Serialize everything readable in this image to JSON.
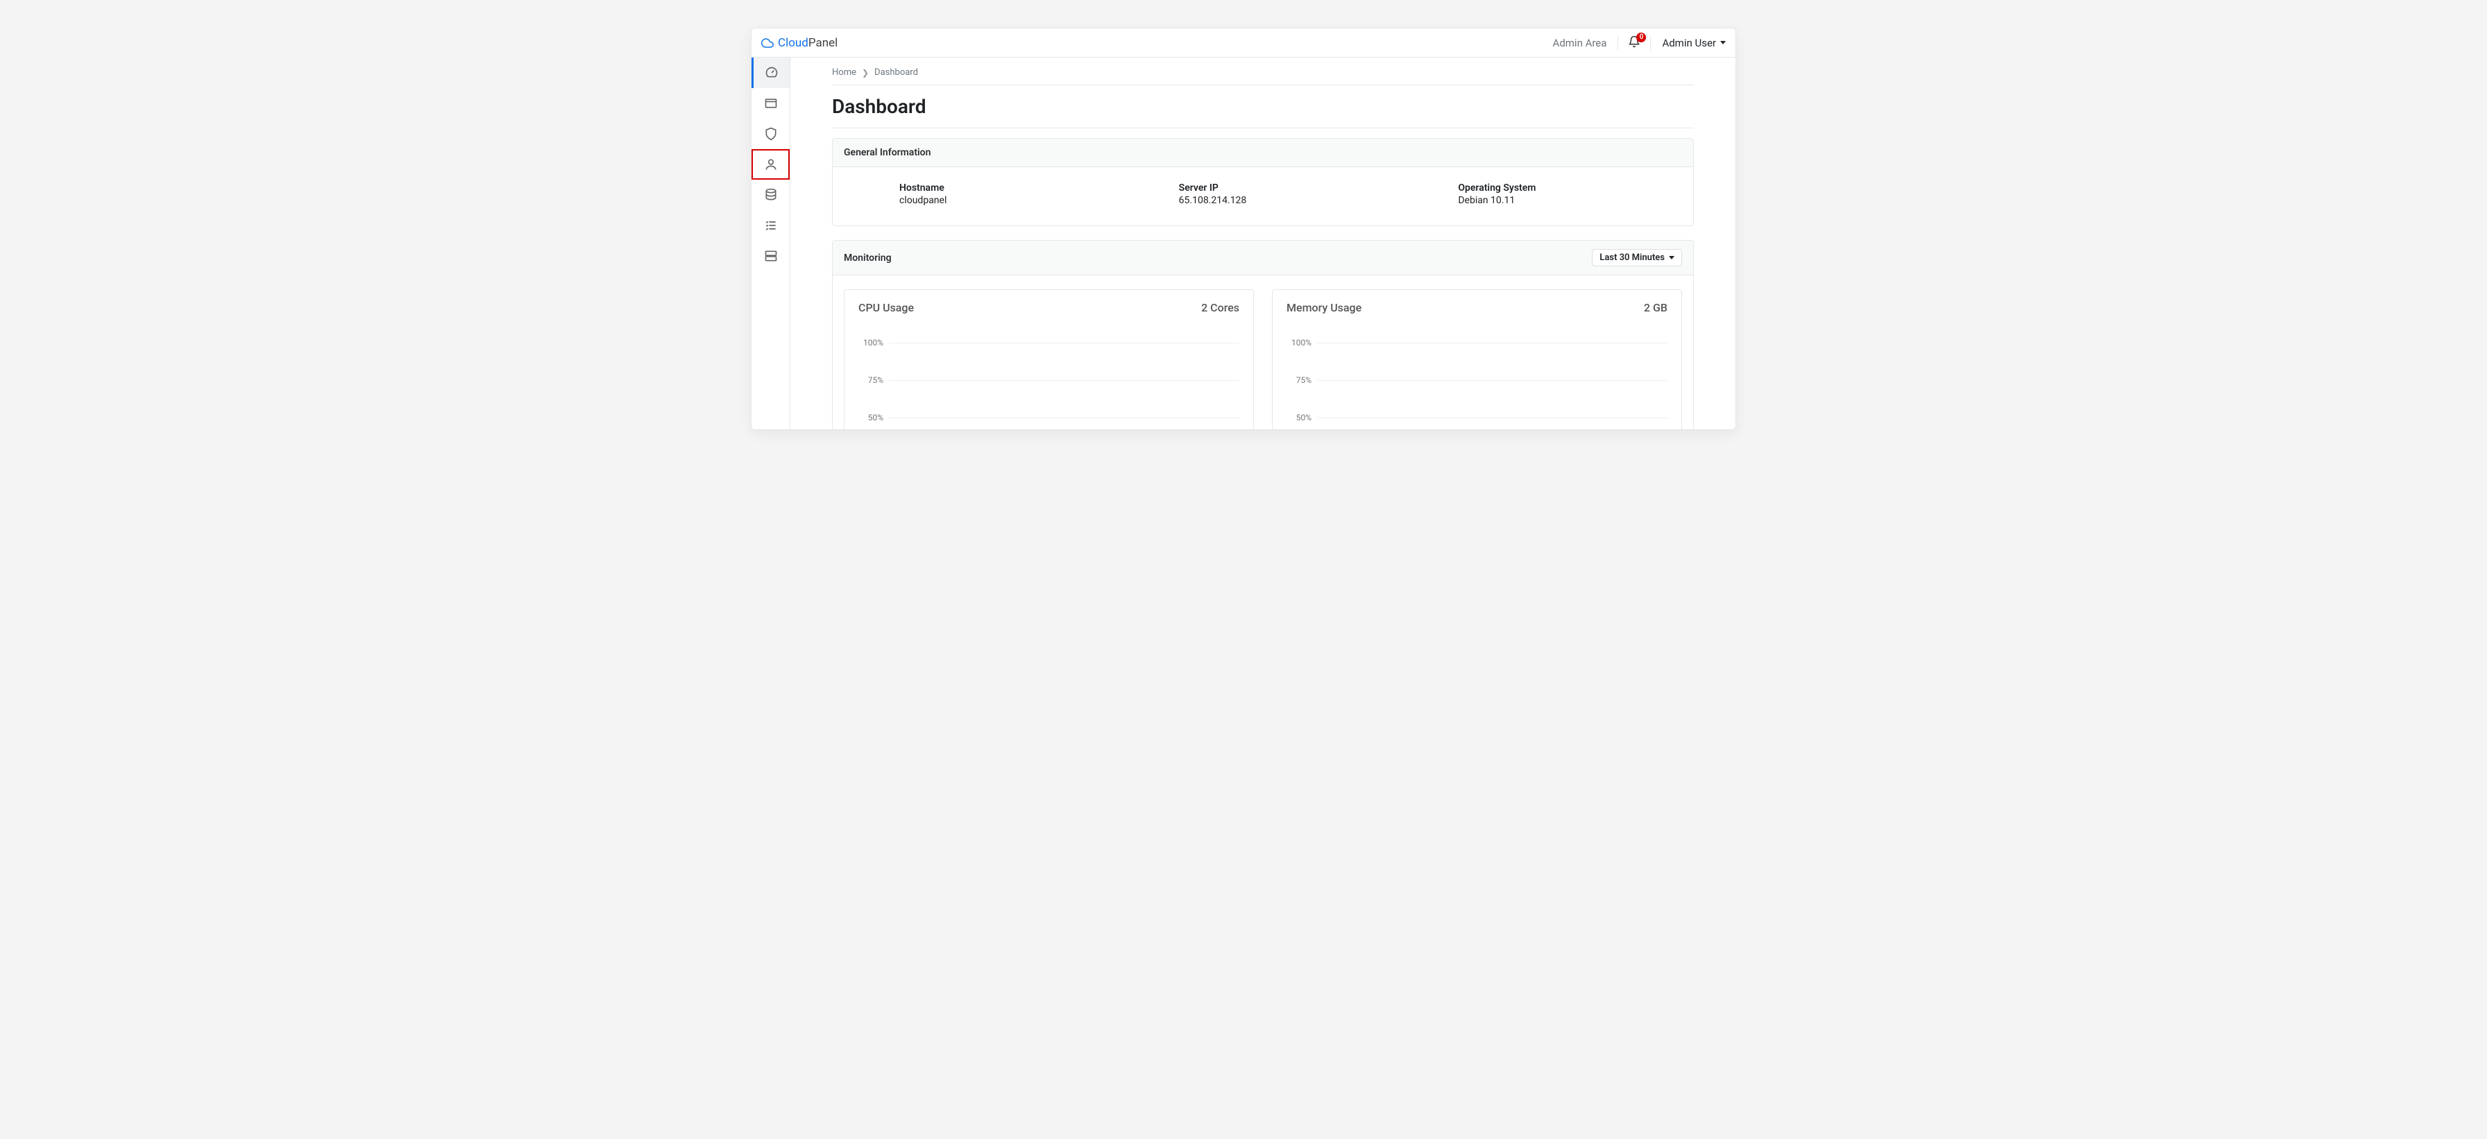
{
  "brand": {
    "cloud": "Cloud",
    "panel": "Panel"
  },
  "header": {
    "admin_area": "Admin Area",
    "notifications_count": "0",
    "user_name": "Admin User"
  },
  "breadcrumb": {
    "home": "Home",
    "current": "Dashboard"
  },
  "page_title": "Dashboard",
  "general": {
    "heading": "General Information",
    "hostname_label": "Hostname",
    "hostname_value": "cloudpanel",
    "server_ip_label": "Server IP",
    "server_ip_value": "65.108.214.128",
    "os_label": "Operating System",
    "os_value": "Debian 10.11"
  },
  "monitoring": {
    "heading": "Monitoring",
    "range_label": "Last 30 Minutes",
    "cpu": {
      "title": "CPU Usage",
      "sub": "2 Cores"
    },
    "memory": {
      "title": "Memory Usage",
      "sub": "2 GB"
    },
    "ticks": {
      "p100": "100%",
      "p75": "75%",
      "p50": "50%"
    }
  },
  "chart_data": [
    {
      "type": "line",
      "title": "CPU Usage",
      "sub": "2 Cores",
      "ylabel": "percent",
      "ylim": [
        0,
        100
      ],
      "yticks": [
        100,
        75,
        50
      ],
      "series": [],
      "x": []
    },
    {
      "type": "line",
      "title": "Memory Usage",
      "sub": "2 GB",
      "ylabel": "percent",
      "ylim": [
        0,
        100
      ],
      "yticks": [
        100,
        75,
        50
      ],
      "series": [],
      "x": []
    }
  ]
}
